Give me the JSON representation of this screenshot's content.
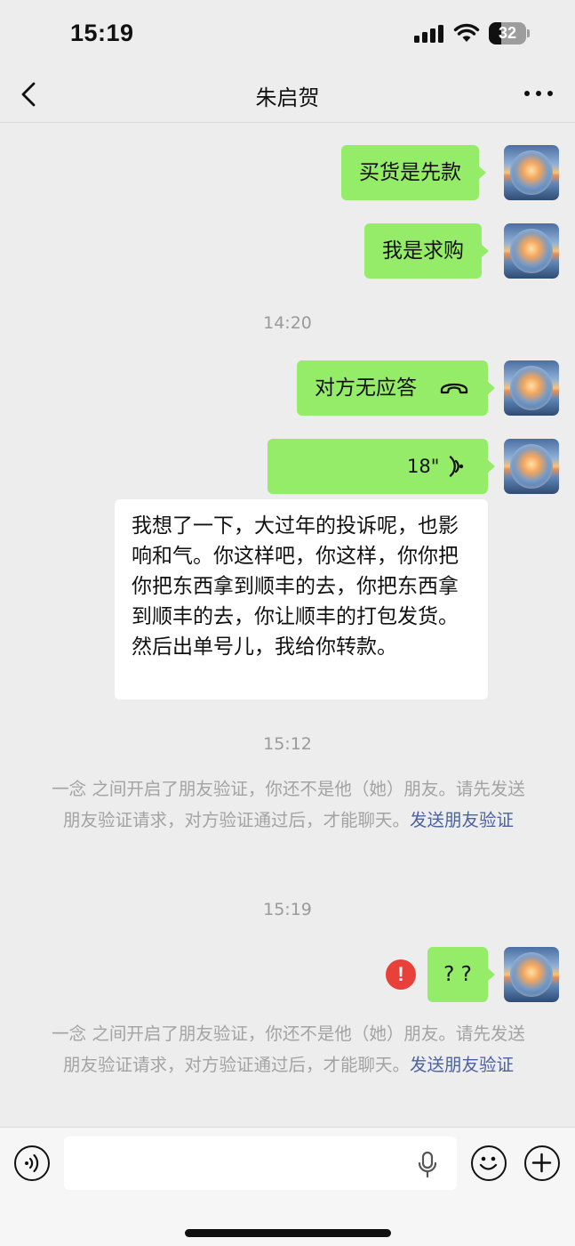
{
  "status_bar": {
    "time": "15:19",
    "battery": "32",
    "icons": [
      "cellular-signal-icon",
      "wifi-icon",
      "battery-icon"
    ]
  },
  "nav": {
    "title": "朱启贺",
    "back_icon": "chevron-left-icon",
    "more_icon": "ellipsis-icon"
  },
  "messages": [
    {
      "type": "text",
      "direction": "out",
      "text": "买货是先款"
    },
    {
      "type": "text",
      "direction": "out",
      "text": "我是求购"
    },
    {
      "type": "time",
      "text": "14:20"
    },
    {
      "type": "call",
      "direction": "out",
      "text": "对方无应答",
      "icon": "hangup-phone-icon"
    },
    {
      "type": "voice",
      "direction": "out",
      "duration": "18\"",
      "icon": "voice-wave-icon"
    },
    {
      "type": "text",
      "direction": "in",
      "text": "我想了一下，大过年的投诉呢，也影响和气。你这样吧，你这样，你你把你把东西拿到顺丰的去，你把东西拿到顺丰的去，你让顺丰的打包发货。然后出单号儿，我给你转款。"
    },
    {
      "type": "time",
      "text": "15:12"
    },
    {
      "type": "system",
      "text": "一念 之间开启了朋友验证，你还不是他（她）朋友。请先发送朋友验证请求，对方验证通过后，才能聊天。",
      "link": "发送朋友验证"
    },
    {
      "type": "time",
      "text": "15:19"
    },
    {
      "type": "text",
      "direction": "out",
      "text": "? ?",
      "failed": true,
      "status_icon": "error-exclamation-icon"
    },
    {
      "type": "system",
      "text": "一念 之间开启了朋友验证，你还不是他（她）朋友。请先发送朋友验证请求，对方验证通过后，才能聊天。",
      "link": "发送朋友验证"
    }
  ],
  "input_bar": {
    "voice_icon": "voice-mode-icon",
    "mic_icon": "microphone-icon",
    "emoji_icon": "emoji-icon",
    "plus_icon": "plus-icon",
    "placeholder": ""
  },
  "colors": {
    "background": "#ededed",
    "bubble_out": "#95ec69",
    "bubble_in": "#ffffff",
    "link": "#4a62a0",
    "error": "#e8413a"
  }
}
